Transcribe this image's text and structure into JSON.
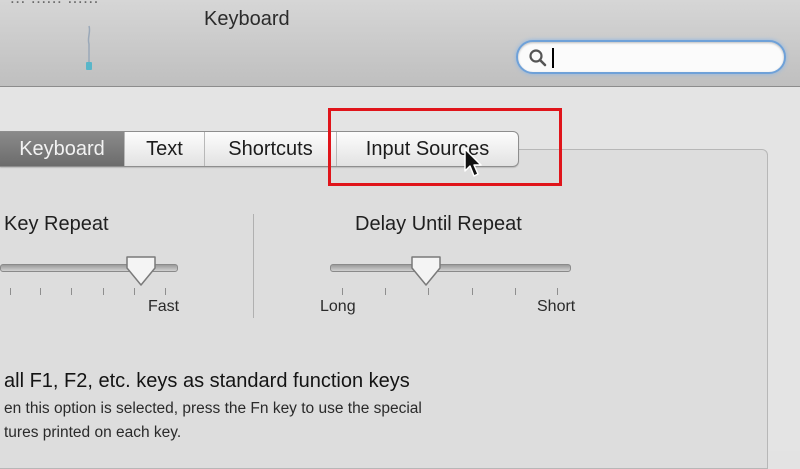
{
  "window": {
    "title_partial": "... ...... ......",
    "title": "Keyboard"
  },
  "search": {
    "value": "",
    "placeholder": ""
  },
  "tabs": [
    {
      "label": "Keyboard",
      "active": true
    },
    {
      "label": "Text",
      "active": false
    },
    {
      "label": "Shortcuts",
      "active": false
    },
    {
      "label": "Input Sources",
      "active": false
    }
  ],
  "key_repeat": {
    "label": "Key Repeat",
    "max_label": "Fast",
    "level": 0.8
  },
  "delay_until_repeat": {
    "label": "Delay Until Repeat",
    "min_label": "Long",
    "max_label": "Short",
    "level": 0.4
  },
  "fn_option": {
    "label": "all F1, F2, etc. keys as standard function keys",
    "desc_line1": "en this option is selected, press the Fn key to use the special",
    "desc_line2": "tures printed on each key."
  },
  "colors": {
    "highlight": "#e0141a",
    "active_tab": "#7a7a7a",
    "search_focus": "#6fa1d8"
  },
  "icons": [
    "search-icon",
    "cursor-icon",
    "toolbar-icon"
  ]
}
